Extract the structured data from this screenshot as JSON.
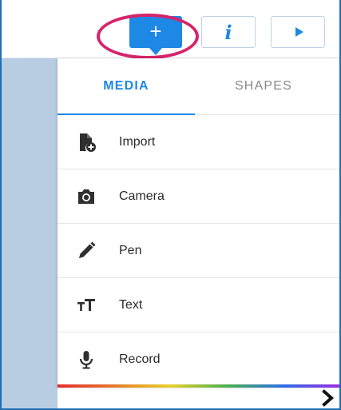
{
  "toolbar": {
    "add_label": "+",
    "info_label": "i"
  },
  "tabs": [
    {
      "label": "MEDIA",
      "active": true
    },
    {
      "label": "SHAPES",
      "active": false
    }
  ],
  "menu_items": [
    {
      "label": "Import",
      "icon": "file-add-icon"
    },
    {
      "label": "Camera",
      "icon": "camera-icon"
    },
    {
      "label": "Pen",
      "icon": "pen-icon"
    },
    {
      "label": "Text",
      "icon": "text-size-icon"
    },
    {
      "label": "Record",
      "icon": "microphone-icon"
    }
  ],
  "colors": {
    "accent": "#1e88e5",
    "highlight": "#d6246b",
    "side_panel": "#b8cce2"
  }
}
